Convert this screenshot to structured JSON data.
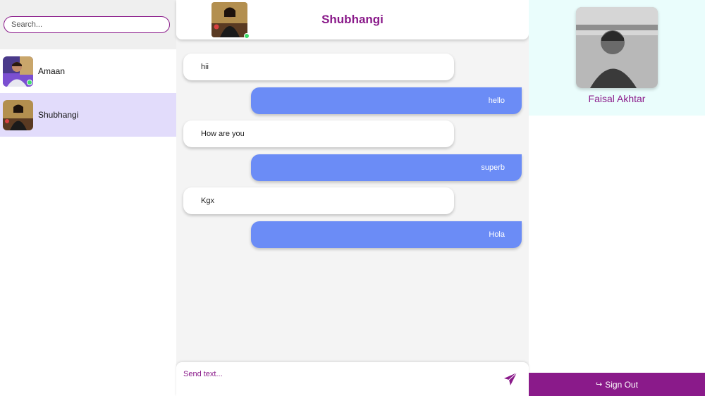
{
  "search": {
    "placeholder": "Search..."
  },
  "contacts": [
    {
      "name": "Amaan",
      "online": true,
      "active": false
    },
    {
      "name": "Shubhangi",
      "online": false,
      "active": true
    }
  ],
  "chat": {
    "title": "Shubhangi",
    "messages": [
      {
        "text": "hii",
        "direction": "received"
      },
      {
        "text": "hello",
        "direction": "sent"
      },
      {
        "text": "How are you",
        "direction": "received"
      },
      {
        "text": "superb",
        "direction": "sent"
      },
      {
        "text": "Kgx",
        "direction": "received"
      },
      {
        "text": "Hola",
        "direction": "sent"
      }
    ],
    "composer_placeholder": "Send text..."
  },
  "profile": {
    "name": "Faisal Akhtar"
  },
  "signout": {
    "label": "Sign Out",
    "icon": "sign-out-icon"
  },
  "colors": {
    "brand": "#8a1a8a",
    "sent_bubble": "#6b8cf6",
    "active_contact": "#e2dcfb",
    "online": "#3ddc6c",
    "profile_bg": "#eafdfc"
  }
}
